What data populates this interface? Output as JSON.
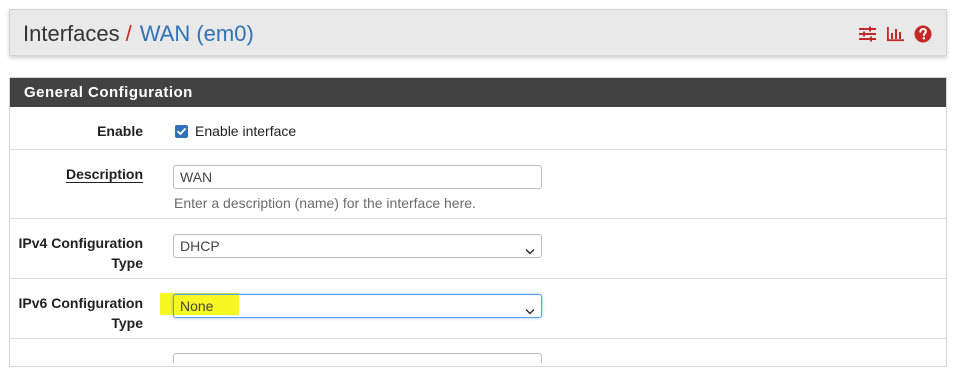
{
  "header": {
    "parent": "Interfaces",
    "separator": "/",
    "current": "WAN (em0)",
    "icons": [
      "settings-sliders-icon",
      "bar-chart-icon",
      "help-icon"
    ]
  },
  "panel": {
    "title": "General Configuration",
    "enable": {
      "label": "Enable",
      "checkbox_label": "Enable interface",
      "checked": true
    },
    "description": {
      "label": "Description",
      "value": "WAN",
      "help": "Enter a description (name) for the interface here."
    },
    "ipv4": {
      "label_line1": "IPv4 Configuration",
      "label_line2": "Type",
      "selected": "DHCP"
    },
    "ipv6": {
      "label_line1": "IPv6 Configuration",
      "label_line2": "Type",
      "selected": "None"
    }
  },
  "colors": {
    "accent": "#2f72b6",
    "danger": "#c62828",
    "heading": "#424242",
    "highlight": "#f7f722"
  }
}
